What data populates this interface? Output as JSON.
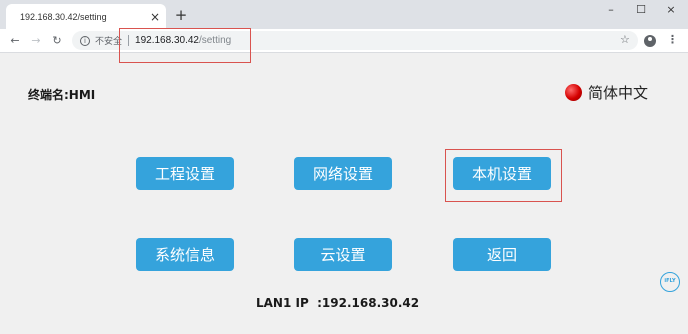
{
  "browser": {
    "tab_title": "192.168.30.42/setting",
    "tab_close": "×",
    "new_tab": "+",
    "window_minimize": "–",
    "window_maximize": "☐",
    "window_close": "×",
    "security_label": "不安全",
    "url_host": "192.168.30.42",
    "url_path": "/setting"
  },
  "header": {
    "terminal_label": "终端名:HMI",
    "language_label": "简体中文",
    "language_indicator_color": "#d40000"
  },
  "buttons": {
    "project_settings": "工程设置",
    "network_settings": "网络设置",
    "local_settings": "本机设置",
    "system_info": "系统信息",
    "cloud_settings": "云设置",
    "back": "返回"
  },
  "footer": {
    "lan_ip": "LAN1 IP  :192.168.30.42",
    "brand_logo": "iFLY"
  },
  "colors": {
    "button_bg": "#35a3dc",
    "highlight_border": "#d9534f"
  }
}
